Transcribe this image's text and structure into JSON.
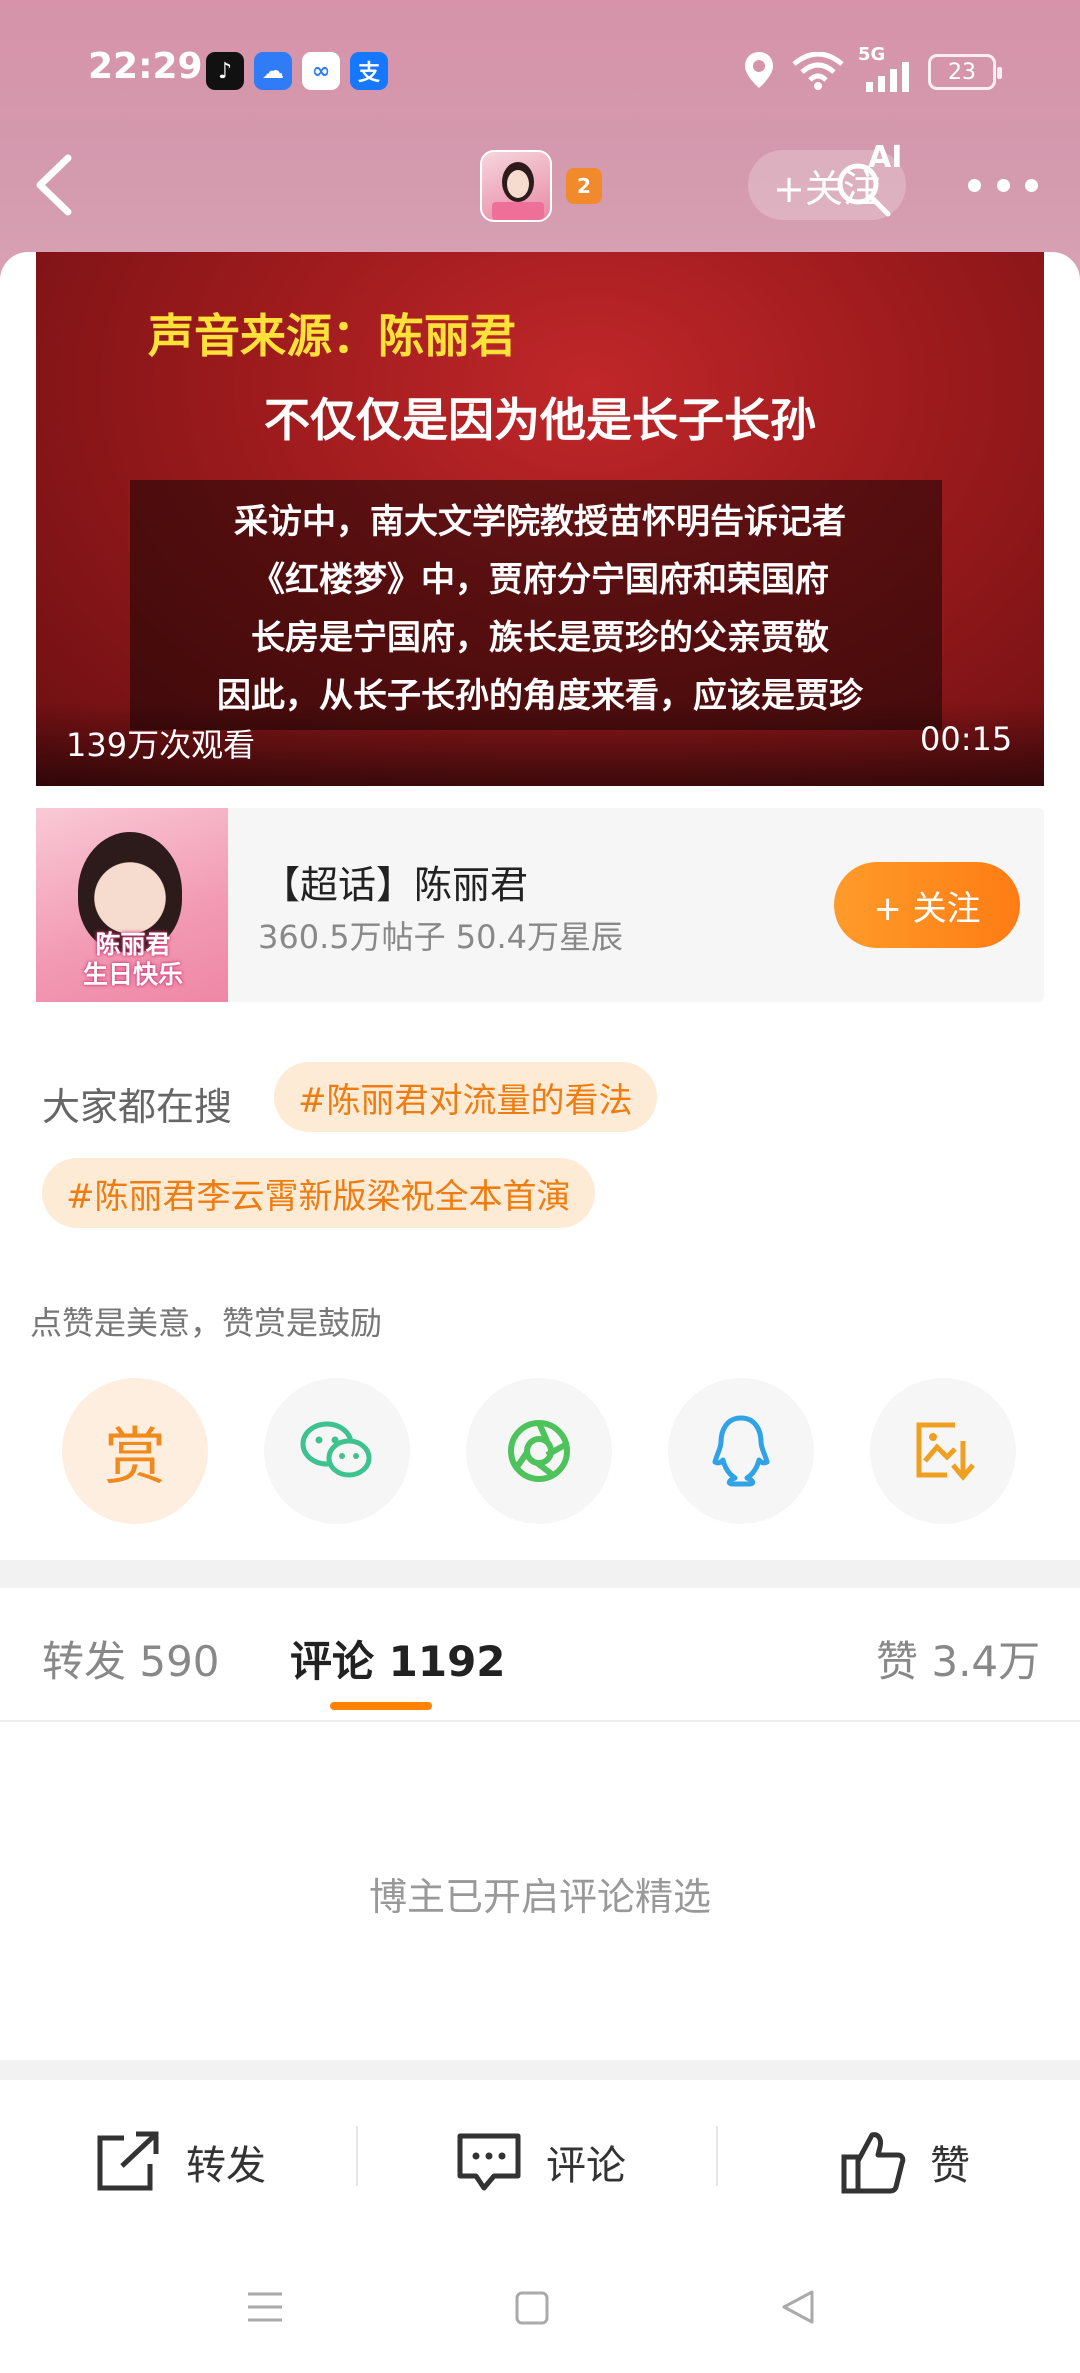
{
  "status_bar": {
    "time": "22:29",
    "network": "5G",
    "battery": "23",
    "app_icons": [
      "douyin-icon",
      "weather-icon",
      "cloud-icon",
      "alipay-icon"
    ]
  },
  "header": {
    "follow_label": "+关注",
    "ai_label": "AI",
    "badge": "2"
  },
  "video": {
    "source_line": "声音来源：陈丽君",
    "headline": "不仅仅是因为他是长子长孙",
    "subtitle_lines": [
      "采访中，南大文学院教授苗怀明告诉记者",
      "《红楼梦》中，贾府分宁国府和荣国府",
      "长房是宁国府，族长是贾珍的父亲贾敬",
      "因此，从长子长孙的角度来看，应该是贾珍"
    ],
    "views": "139万次观看",
    "duration": "00:15"
  },
  "super_topic": {
    "title": "【超话】陈丽君",
    "stats": "360.5万帖子 50.4万星辰",
    "image_caption": [
      "陈丽君",
      "生日快乐"
    ],
    "follow_label": "+ 关注"
  },
  "trending": {
    "label": "大家都在搜",
    "tags": [
      "#陈丽君对流量的看法",
      "#陈丽君李云霄新版梁祝全本首演"
    ]
  },
  "reward": {
    "tip": "点赞是美意，赞赏是鼓励",
    "reward_label": "赏"
  },
  "tabs": {
    "repost": "转发 590",
    "comments": "评论 1192",
    "likes": "赞 3.4万"
  },
  "comment_note": "博主已开启评论精选",
  "bottom_bar": {
    "repost": "转发",
    "comment": "评论",
    "like": "赞"
  },
  "colors": {
    "accent": "#ff8200",
    "header_bg": "#d693aa",
    "tag_bg": "#fdebd6"
  }
}
